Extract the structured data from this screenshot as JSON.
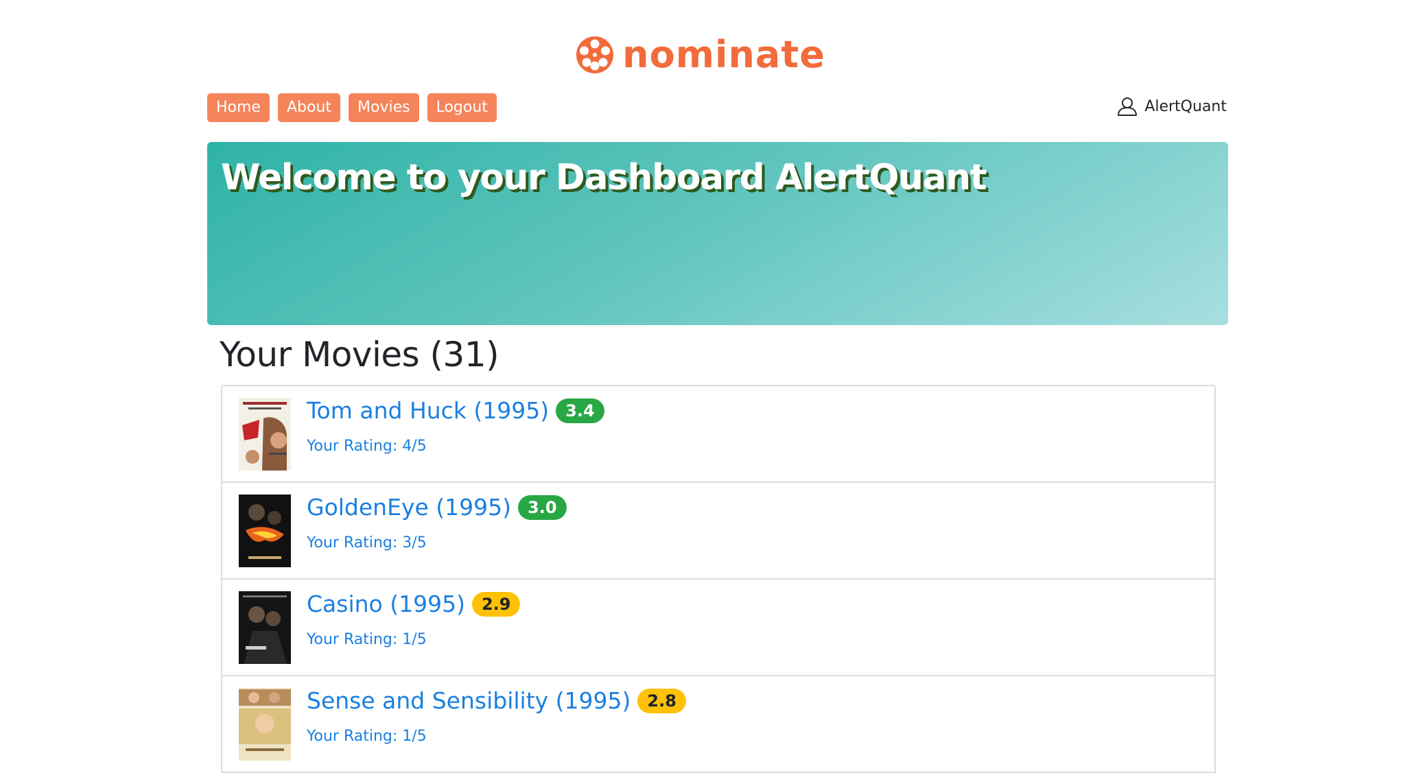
{
  "brand": {
    "name": "nominate",
    "color": "#f26b3a"
  },
  "nav": {
    "items": [
      "Home",
      "About",
      "Movies",
      "Logout"
    ]
  },
  "user": {
    "name": "AlertQuant",
    "icon": "user-icon"
  },
  "hero": {
    "title": "Welcome to your Dashboard AlertQuant"
  },
  "movies_section": {
    "title": "Your Movies (31)"
  },
  "movies": [
    {
      "title": "Tom and Huck (1995)",
      "score": "3.4",
      "score_color": "green",
      "rating": "Your Rating: 4/5"
    },
    {
      "title": "GoldenEye (1995)",
      "score": "3.0",
      "score_color": "green",
      "rating": "Your Rating: 3/5"
    },
    {
      "title": "Casino (1995)",
      "score": "2.9",
      "score_color": "yellow",
      "rating": "Your Rating: 1/5"
    },
    {
      "title": "Sense and Sensibility (1995)",
      "score": "2.8",
      "score_color": "yellow",
      "rating": "Your Rating: 1/5"
    }
  ],
  "colors": {
    "nav_button": "#f5845b",
    "link": "#1a7fe0",
    "badge_green": "#28a745",
    "badge_yellow": "#ffc107",
    "hero_start": "#2fb3a6",
    "hero_end": "#a7dfe0"
  }
}
